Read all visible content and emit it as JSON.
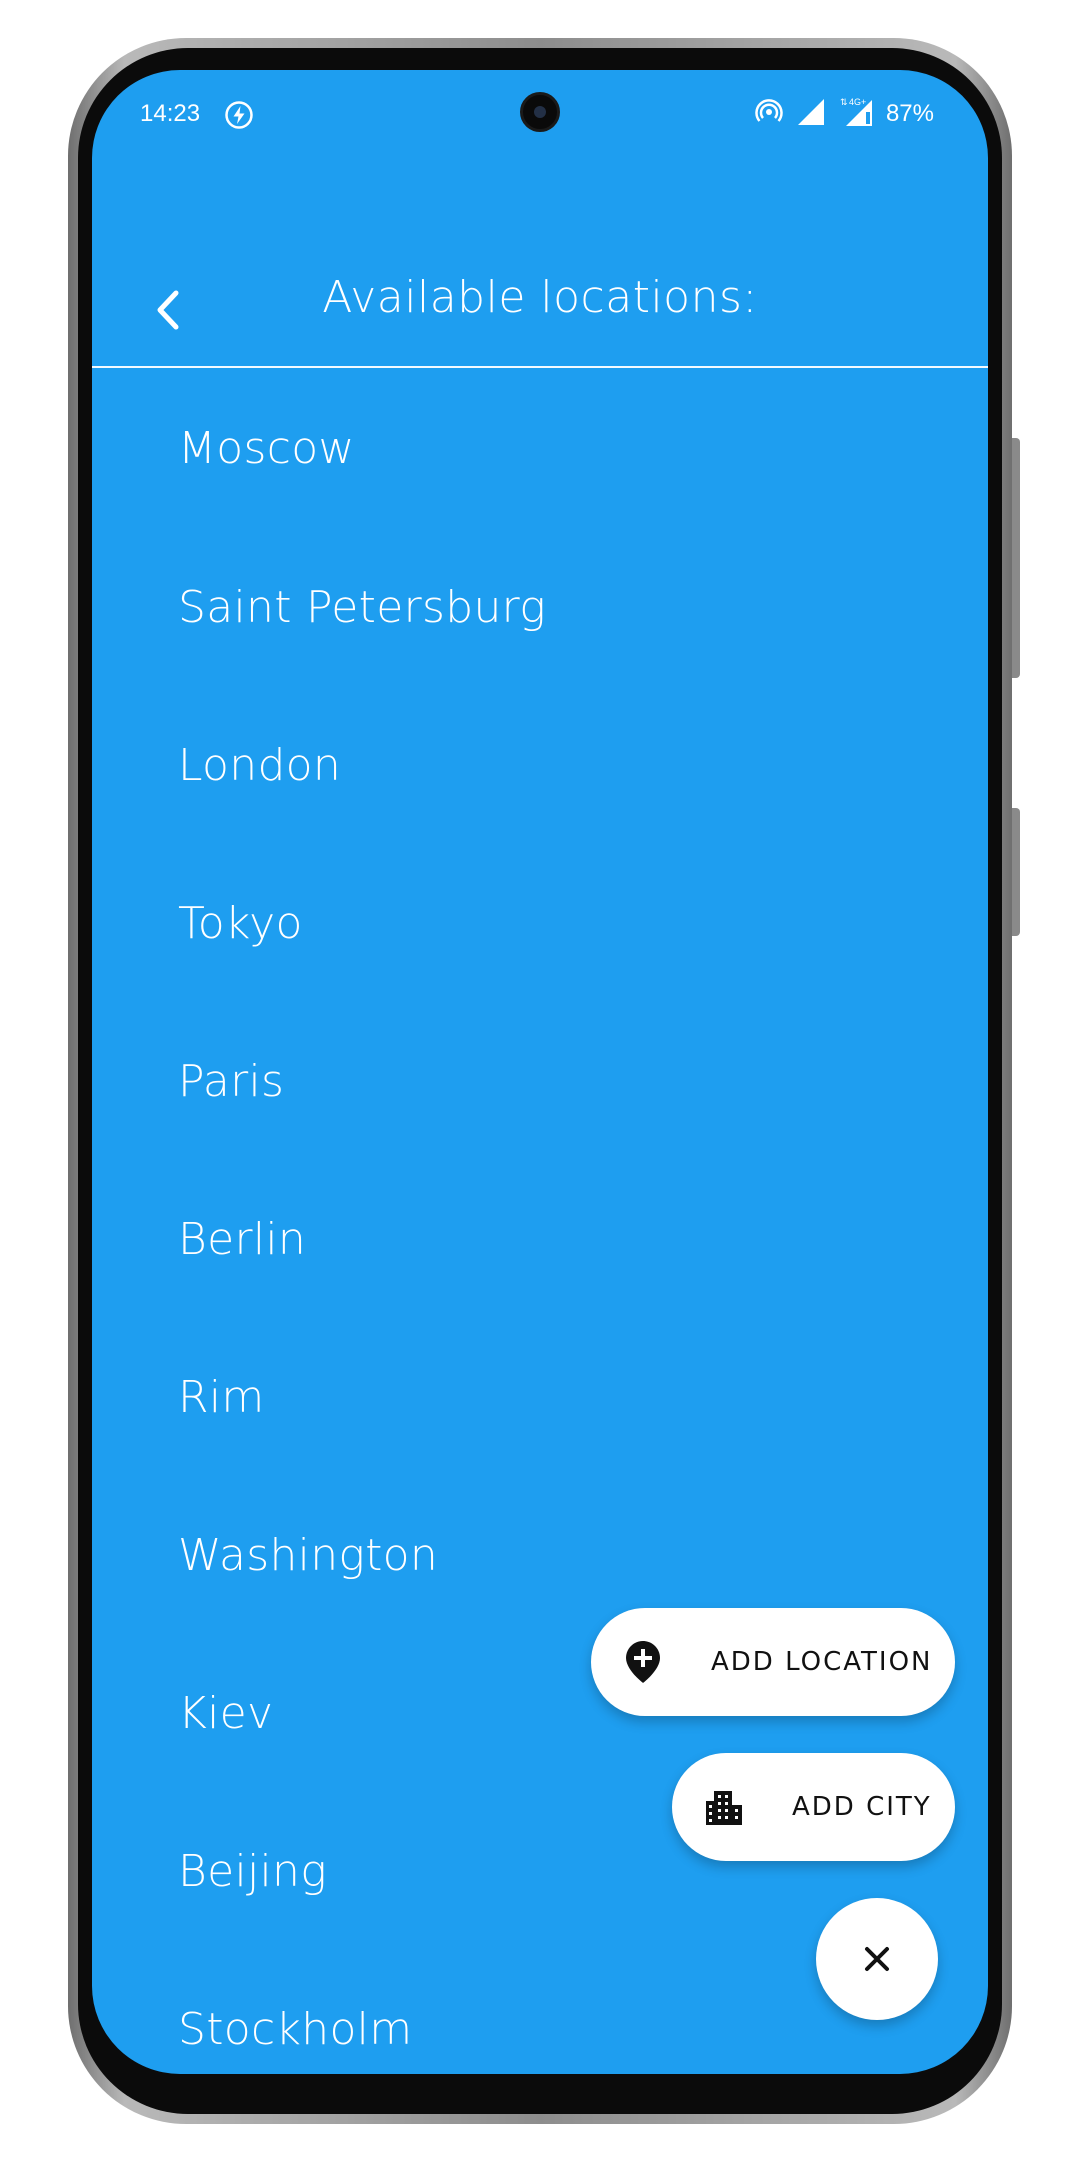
{
  "status_bar": {
    "time": "14:23",
    "battery": "87%",
    "network": "4G+",
    "icons": [
      "power-save-bolt-icon",
      "hotspot-icon",
      "wifi-signal-icon",
      "cell-signal-icon"
    ]
  },
  "app_bar": {
    "title": "Available locations:",
    "back_icon": "chevron-left-icon"
  },
  "locations": [
    "Moscow",
    "Saint Petersburg",
    "London",
    "Tokyo",
    "Paris",
    "Berlin",
    "Rim",
    "Washington",
    "Kiev",
    "Beijing",
    "Stockholm"
  ],
  "fab_menu": {
    "add_location_label": "ADD LOCATION",
    "add_location_icon": "add-location-pin-icon",
    "add_city_label": "ADD CITY",
    "add_city_icon": "city-buildings-icon",
    "close_icon": "close-icon"
  },
  "colors": {
    "background": "#1e9ef0",
    "text": "#ffffff",
    "fab_background": "#ffffff",
    "fab_text": "#111111"
  }
}
